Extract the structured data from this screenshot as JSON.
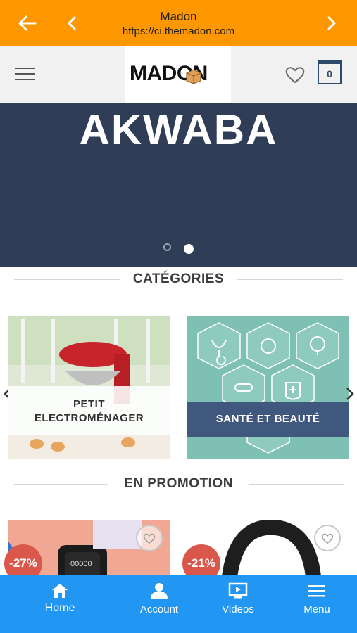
{
  "browser": {
    "title": "Madon",
    "url": "https://ci.themadon.com",
    "back_icon": "arrow-left-icon",
    "prev_icon": "chevron-left-icon",
    "next_icon": "chevron-right-icon"
  },
  "header": {
    "logo": "MADON",
    "cart_count": "0",
    "colors": {
      "nav_bar": "#ff9800",
      "accent": "#2f4a6b"
    }
  },
  "hero": {
    "text": "AKWABA",
    "background": "#2f3e56"
  },
  "categories": {
    "title": "CATÉGORIES",
    "items": [
      {
        "label_line1": "PETIT",
        "label_line2": "ELECTROMÉNAGER"
      },
      {
        "label": "SANTÉ ET BEAUTÉ"
      }
    ]
  },
  "promotions": {
    "title": "EN PROMOTION",
    "items": [
      {
        "discount": "-27%"
      },
      {
        "discount": "-21%"
      }
    ]
  },
  "bottom_nav": {
    "color": "#2196f3",
    "tabs": [
      {
        "label": "Home",
        "icon": "home-icon"
      },
      {
        "label": "Account",
        "icon": "user-icon"
      },
      {
        "label": "Videos",
        "icon": "video-icon"
      },
      {
        "label": "Menu",
        "icon": "menu-icon"
      }
    ]
  }
}
